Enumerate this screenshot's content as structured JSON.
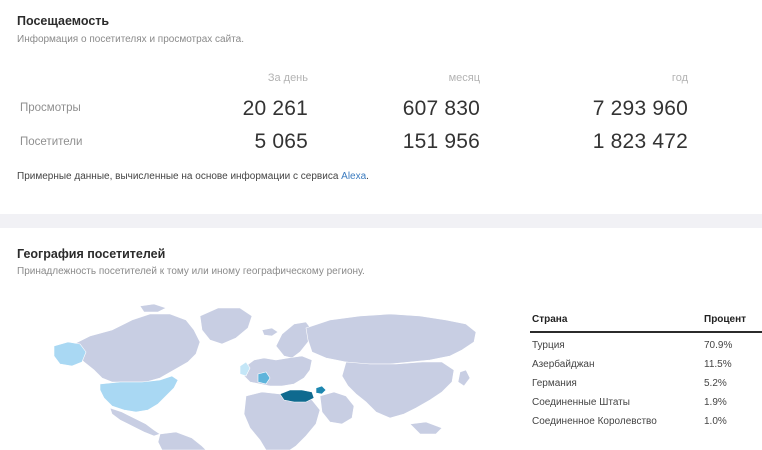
{
  "traffic": {
    "title": "Посещаемость",
    "subtitle": "Информация о посетителях и просмотрах сайта.",
    "columns": [
      "За день",
      "месяц",
      "год"
    ],
    "rows": [
      {
        "label": "Просмотры",
        "values": [
          "20 261",
          "607 830",
          "7 293 960"
        ]
      },
      {
        "label": "Посетители",
        "values": [
          "5 065",
          "151 956",
          "1 823 472"
        ]
      }
    ],
    "note_text": "Примерные данные, вычисленные на основе информации с сервиса ",
    "note_link": "Alexa",
    "note_end": "."
  },
  "geo": {
    "title": "География посетителей",
    "subtitle": "Принадлежность посетителей к тому или иному географическому региону.",
    "table_headers": {
      "country": "Страна",
      "percent": "Процент"
    },
    "rows": [
      {
        "country": "Турция",
        "percent": "70.9%"
      },
      {
        "country": "Азербайджан",
        "percent": "11.5%"
      },
      {
        "country": "Германия",
        "percent": "5.2%"
      },
      {
        "country": "Соединенные Штаты",
        "percent": "1.9%"
      },
      {
        "country": "Соединенное Королевство",
        "percent": "1.0%"
      }
    ],
    "map_colors": {
      "land": "#c8cee3",
      "turkey": "#0f6a8f",
      "azerbaijan": "#1d87b0",
      "germany": "#5fb4db",
      "usa": "#a9d8f3",
      "uk": "#c4e6f7"
    }
  }
}
